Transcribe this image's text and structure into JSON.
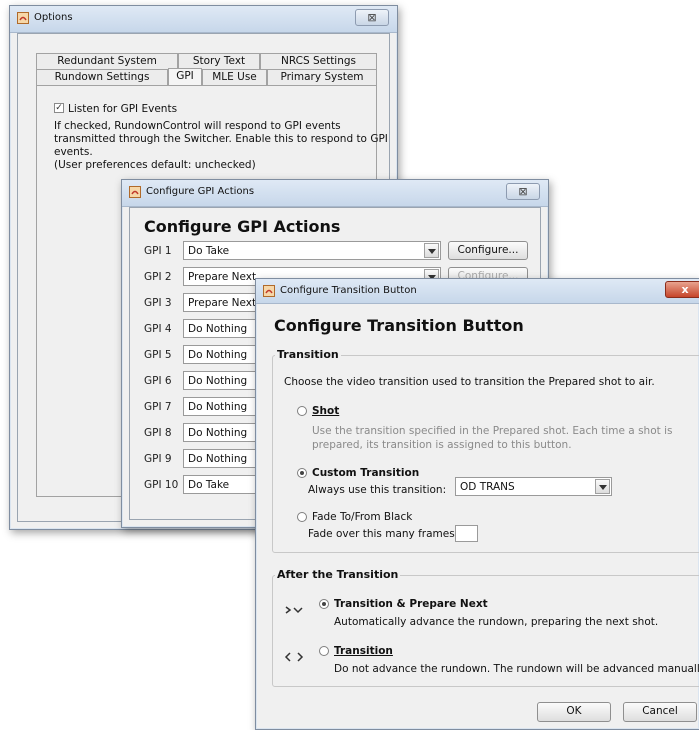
{
  "options": {
    "title": "Options",
    "close_label": "⊠",
    "tabs_row1": [
      "Redundant System",
      "Story Text",
      "NRCS Settings"
    ],
    "tabs_row2": [
      "Rundown Settings",
      "GPI",
      "MLE Use",
      "Primary System"
    ],
    "listen_checkbox_label": "Listen for GPI Events",
    "desc_lines": [
      "If checked, RundownControl will respond to GPI events",
      "transmitted through the Switcher. Enable this to respond to GPI",
      "events.",
      "(User preferences default: unchecked)"
    ]
  },
  "gpi_dialog": {
    "title": "Configure GPI Actions",
    "heading": "Configure GPI Actions",
    "configure_label": "Configure...",
    "rows": [
      {
        "label": "GPI 1",
        "value": "Do Take"
      },
      {
        "label": "GPI 2",
        "value": "Prepare Next"
      },
      {
        "label": "GPI 3",
        "value": "Prepare Next"
      },
      {
        "label": "GPI 4",
        "value": "Do Nothing"
      },
      {
        "label": "GPI 5",
        "value": "Do Nothing"
      },
      {
        "label": "GPI 6",
        "value": "Do Nothing"
      },
      {
        "label": "GPI 7",
        "value": "Do Nothing"
      },
      {
        "label": "GPI 8",
        "value": "Do Nothing"
      },
      {
        "label": "GPI 9",
        "value": "Do Nothing"
      },
      {
        "label": "GPI 10",
        "value": "Do Take"
      }
    ]
  },
  "transition_dialog": {
    "title": "Configure Transition Button",
    "heading": "Configure Transition Button",
    "close_label": "x",
    "transition_legend": "Transition",
    "transition_intro": "Choose the video transition used to transition the Prepared shot to air.",
    "shot_label": "Shot",
    "shot_desc_1": "Use the transition specified in the Prepared shot.  Each time a shot is",
    "shot_desc_2": "prepared, its transition is assigned to this button.",
    "custom_label": "Custom Transition",
    "always_use_label": "Always use this transition:",
    "custom_value": "OD TRANS",
    "fade_label": "Fade To/From Black",
    "fade_frames_label": "Fade over this many frames:",
    "fade_frames_value": "",
    "after_legend": "After the Transition",
    "prep_next_label": "Transition & Prepare Next",
    "prep_next_desc": "Automatically advance the rundown, preparing the next shot.",
    "trans_only_label": "Transition",
    "trans_only_desc": "Do not advance the rundown.  The rundown will be advanced manually.",
    "ok_label": "OK",
    "cancel_label": "Cancel",
    "selected_transition": "custom",
    "selected_after": "transition-prepare-next"
  }
}
